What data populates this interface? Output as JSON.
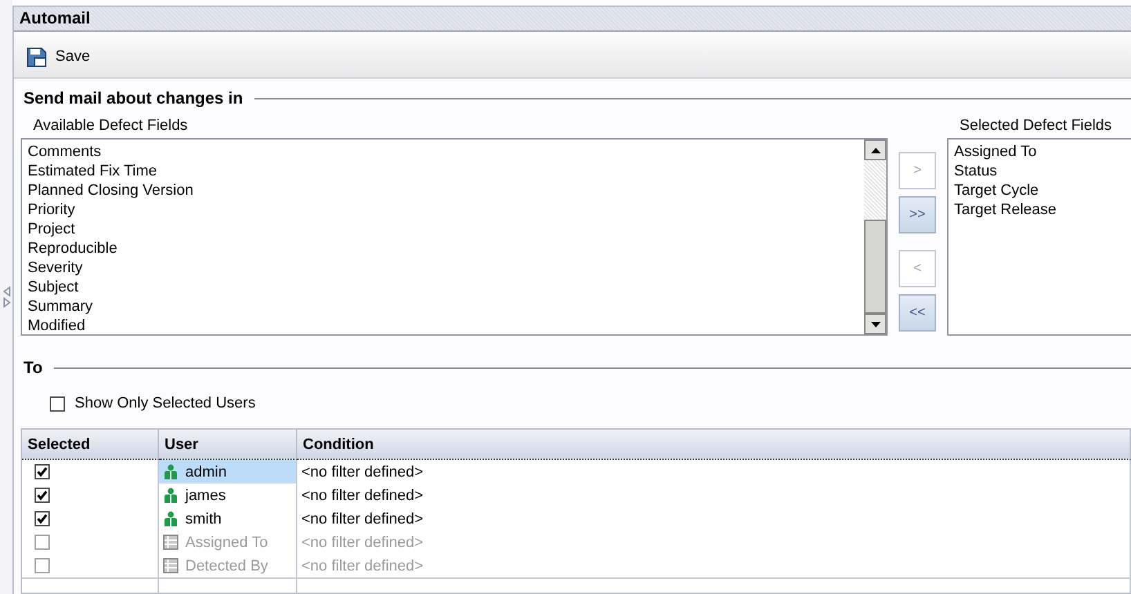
{
  "window": {
    "title": "Automail"
  },
  "toolbar": {
    "buttons": [
      {
        "label": "Save"
      }
    ]
  },
  "send_mail": {
    "heading": "Send mail about changes in",
    "available": {
      "label": "Available Defect Fields",
      "items": [
        "Comments",
        "Estimated Fix Time",
        "Planned Closing Version",
        "Priority",
        "Project",
        "Reproducible",
        "Severity",
        "Subject",
        "Summary",
        "Modified"
      ]
    },
    "move_buttons": [
      {
        "label": ">",
        "disabled": true
      },
      {
        "label": ">>",
        "disabled": false
      },
      {
        "label": "<",
        "disabled": true
      },
      {
        "label": "<<",
        "disabled": false
      }
    ],
    "selected": {
      "label": "Selected Defect Fields",
      "items": [
        "Assigned To",
        "Status",
        "Target Cycle",
        "Target Release"
      ]
    }
  },
  "to": {
    "heading": "To",
    "show_only_selected": {
      "label": "Show Only Selected Users",
      "checked": false
    },
    "table": {
      "columns": [
        "Selected",
        "User",
        "Condition"
      ],
      "rows": [
        {
          "checked": true,
          "kind": "user",
          "user": "admin",
          "condition": "<no filter defined>",
          "selected": true,
          "disabled": false
        },
        {
          "checked": true,
          "kind": "user",
          "user": "james",
          "condition": "<no filter defined>",
          "selected": false,
          "disabled": false
        },
        {
          "checked": true,
          "kind": "user",
          "user": "smith",
          "condition": "<no filter defined>",
          "selected": false,
          "disabled": false
        },
        {
          "checked": false,
          "kind": "group",
          "user": "Assigned To",
          "condition": "<no filter defined>",
          "selected": false,
          "disabled": true
        },
        {
          "checked": false,
          "kind": "group",
          "user": "Detected By",
          "condition": "<no filter defined>",
          "selected": false,
          "disabled": true
        }
      ]
    }
  }
}
